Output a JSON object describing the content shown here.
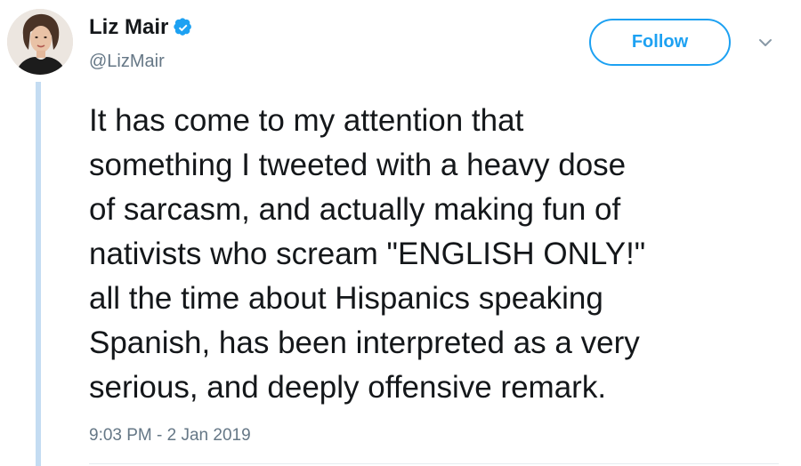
{
  "author": {
    "display_name": "Liz Mair",
    "handle": "@LizMair",
    "verified": true,
    "avatar_icon": "profile-photo"
  },
  "actions": {
    "follow_label": "Follow",
    "more_icon": "chevron-down-icon"
  },
  "tweet": {
    "lines": [
      "It has come to my attention that",
      "something I tweeted with a heavy dose",
      "of sarcasm, and actually making fun of",
      "nativists who scream \"ENGLISH ONLY!\"",
      "all the time about Hispanics speaking",
      "Spanish, has been interpreted as a very",
      "serious, and deeply offensive remark."
    ],
    "timestamp": "9:03 PM - 2 Jan 2019"
  },
  "colors": {
    "accent": "#1da1f2",
    "text": "#14171a",
    "muted": "#657786",
    "thread_line": "#c4dcf2"
  }
}
